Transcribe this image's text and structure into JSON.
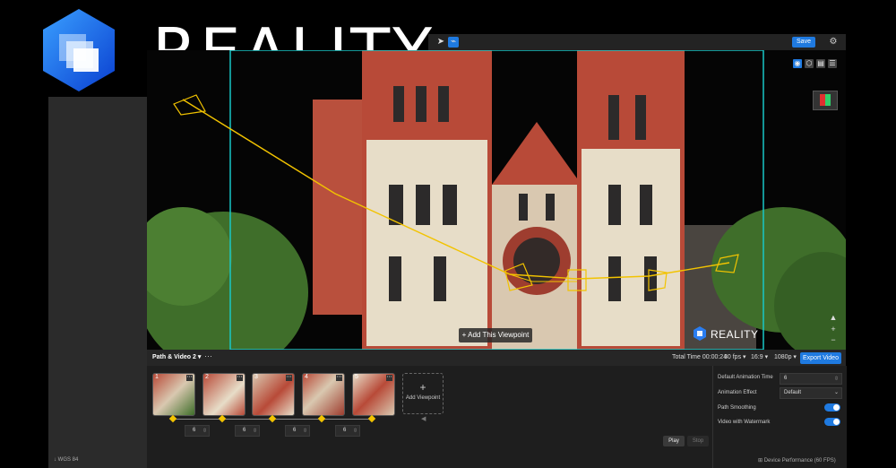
{
  "brand": {
    "text": "REALITY"
  },
  "topbar": {
    "save_label": "Save",
    "icons": [
      "cursor-icon",
      "path-icon",
      "gear-icon"
    ]
  },
  "viewport": {
    "add_viewpoint_label": "+ Add This Viewpoint",
    "watermark_text": "REALITY",
    "side_tools": [
      "▲",
      "+",
      "−"
    ]
  },
  "panel": {
    "tab_label": "Path & Video 2 ▾",
    "more": "···",
    "total_time": "Total Time 00:00:24",
    "fps": "30 fps ▾",
    "ratio": "16:9 ▾",
    "resolution": "1080p ▾",
    "export_label": "Export Video",
    "thumbnails": [
      {
        "num": "1"
      },
      {
        "num": "2"
      },
      {
        "num": "3"
      },
      {
        "num": "4"
      },
      {
        "num": "5"
      }
    ],
    "add_viewpoint": {
      "plus": "+",
      "label": "Add Viewpoint"
    },
    "durations": [
      "6",
      "6",
      "6",
      "6"
    ],
    "play_label": "Play",
    "stop_label": "Stop"
  },
  "settings": {
    "default_time_label": "Default Animation Time",
    "default_time_value": "6",
    "effect_label": "Animation Effect",
    "effect_value": "Default",
    "smoothing_label": "Path Smoothing",
    "watermark_label": "Video with Watermark"
  },
  "footer": {
    "left": "↓ WGS 84",
    "right": "⊞ Device Performance  (60 FPS)"
  },
  "colors": {
    "accent": "#1f7ae0",
    "path": "#f2c300"
  }
}
